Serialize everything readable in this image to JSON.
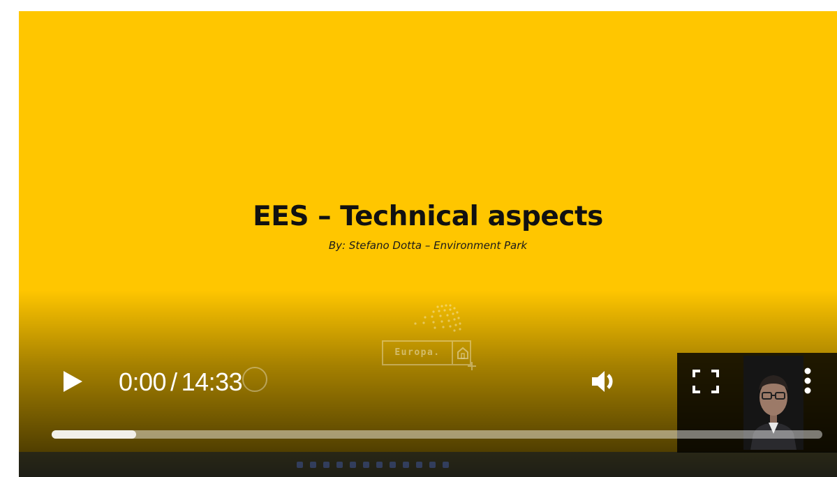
{
  "slide": {
    "title": "EES – Technical aspects",
    "subtitle": "By: Stefano Dotta – Environment Park",
    "logo_text": "Europa.",
    "background_color": "#ffc600"
  },
  "player": {
    "current_time": "0:00",
    "separator": "/",
    "duration": "14:33",
    "progress_fraction": 0.0,
    "buffered_fraction": 0.11
  },
  "icons": {
    "play": "play-icon",
    "volume": "volume-icon",
    "fullscreen": "fullscreen-icon",
    "more": "more-vertical-icon"
  }
}
